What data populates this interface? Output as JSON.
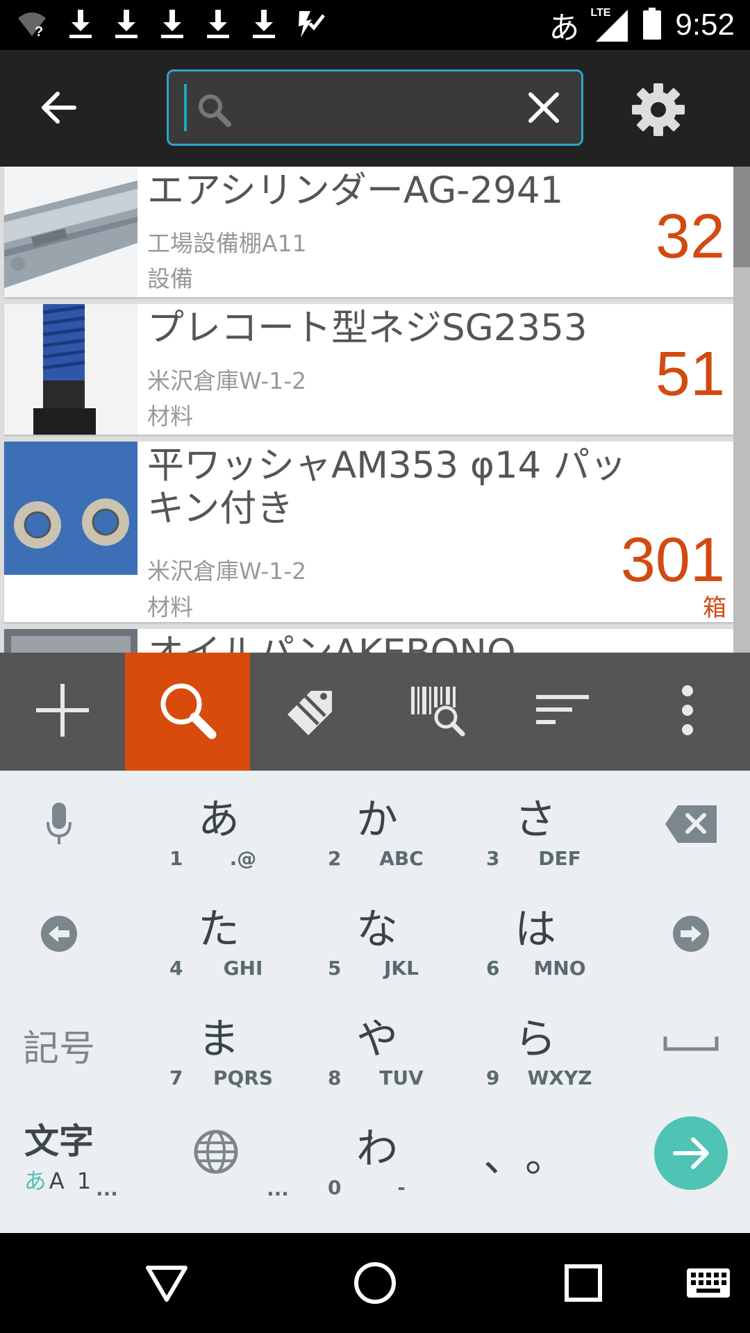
{
  "status_bar": {
    "time": "9:52",
    "ime_indicator": "あ",
    "network": "LTE",
    "icons": [
      "wifi-unknown-icon",
      "download-icon",
      "download-icon",
      "download-icon",
      "download-icon",
      "download-icon",
      "task-check-icon",
      "signal-icon",
      "battery-icon"
    ]
  },
  "app_bar": {
    "back_icon": "arrow-back-icon",
    "search": {
      "value": "",
      "placeholder": "",
      "icon": "search-icon",
      "clear_icon": "close-icon"
    },
    "settings_icon": "gear-icon"
  },
  "items": [
    {
      "title": "エアシリンダーAG-2941",
      "location": "工場設備棚A11",
      "category": "設備",
      "quantity": "32",
      "unit": ""
    },
    {
      "title": "プレコート型ネジSG2353",
      "location": "米沢倉庫W-1-2",
      "category": "材料",
      "quantity": "51",
      "unit": ""
    },
    {
      "title": "平ワッシャAM353 φ14 パッキン付き",
      "location": "米沢倉庫W-1-2",
      "category": "材料",
      "quantity": "301",
      "unit": "箱"
    },
    {
      "title": "オイルパンAKEBONO",
      "location": "",
      "category": "",
      "quantity": "",
      "unit": ""
    }
  ],
  "toolbar": {
    "buttons": [
      "add-icon",
      "search-icon",
      "edit-tag-icon",
      "barcode-search-icon",
      "sort-icon",
      "more-vert-icon"
    ],
    "active_index": 1
  },
  "keyboard": {
    "keys": [
      {
        "main": "あ",
        "num": "1",
        "letters": ".@"
      },
      {
        "main": "か",
        "num": "2",
        "letters": "ABC"
      },
      {
        "main": "さ",
        "num": "3",
        "letters": "DEF"
      },
      {
        "main": "た",
        "num": "4",
        "letters": "GHI"
      },
      {
        "main": "な",
        "num": "5",
        "letters": "JKL"
      },
      {
        "main": "は",
        "num": "6",
        "letters": "MNO"
      },
      {
        "main": "ま",
        "num": "7",
        "letters": "PQRS"
      },
      {
        "main": "や",
        "num": "8",
        "letters": "TUV"
      },
      {
        "main": "ら",
        "num": "9",
        "letters": "WXYZ"
      },
      {
        "main": "わ",
        "num": "0",
        "letters": "-"
      }
    ],
    "kigo_label": "記号",
    "moji_label": "文字",
    "moji_sub_a": "あ",
    "moji_sub_rest": "A 1",
    "moji_dots": "...",
    "globe_dots": "...",
    "punct_label": "、。",
    "accent": "#4fc3b4"
  },
  "nav_bar": {
    "icons": [
      "back-triangle-icon",
      "home-circle-icon",
      "recents-square-icon",
      "keyboard-icon"
    ]
  },
  "colors": {
    "accent": "#d84b0d",
    "quantity": "#d34a10",
    "search_border": "#29a8c7"
  }
}
